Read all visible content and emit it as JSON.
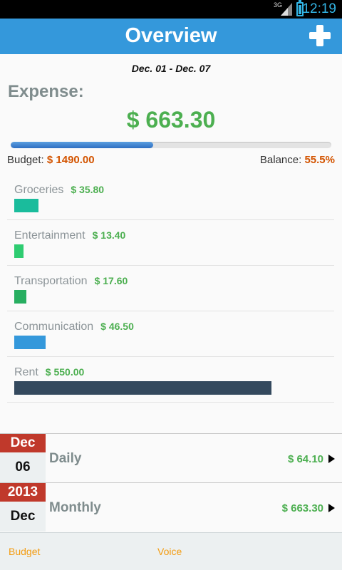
{
  "status_bar": {
    "network": "3G",
    "time": "12:19",
    "accent": "#33b5e5"
  },
  "app_bar": {
    "title": "Overview",
    "add_icon": "plus-icon",
    "color": "#3498db"
  },
  "period": {
    "date_range": "Dec. 01 - Dec. 07"
  },
  "expense": {
    "label": "Expense:",
    "total": "$ 663.30",
    "budget_label": "Budget:",
    "budget_value": "$ 1490.00",
    "balance_label": "Balance:",
    "balance_value": "55.5%",
    "spent_fraction": 0.445
  },
  "categories": [
    {
      "name": "Groceries",
      "amount": "$ 35.80",
      "color": "#1abc9c",
      "bar_value": 35.8
    },
    {
      "name": "Entertainment",
      "amount": "$ 13.40",
      "color": "#2ecc71",
      "bar_value": 13.4
    },
    {
      "name": "Transportation",
      "amount": "$ 17.60",
      "color": "#27ae60",
      "bar_value": 17.6
    },
    {
      "name": "Communication",
      "amount": "$ 46.50",
      "color": "#3498db",
      "bar_value": 46.5
    },
    {
      "name": "Rent",
      "amount": "$ 550.00",
      "color": "#34495e",
      "bar_value": 550.0
    }
  ],
  "summary": [
    {
      "badge_top": "Dec",
      "badge_bottom": "06",
      "label": "Daily",
      "value": "$ 64.10"
    },
    {
      "badge_top": "2013",
      "badge_bottom": "Dec",
      "label": "Monthly",
      "value": "$ 663.30"
    }
  ],
  "bottom_tabs": {
    "budget": "Budget",
    "voice": "Voice"
  },
  "colors": {
    "positive": "#4caf50",
    "highlight": "#d35400",
    "badge_red": "#c0392b",
    "tab_text": "#f39c12"
  }
}
